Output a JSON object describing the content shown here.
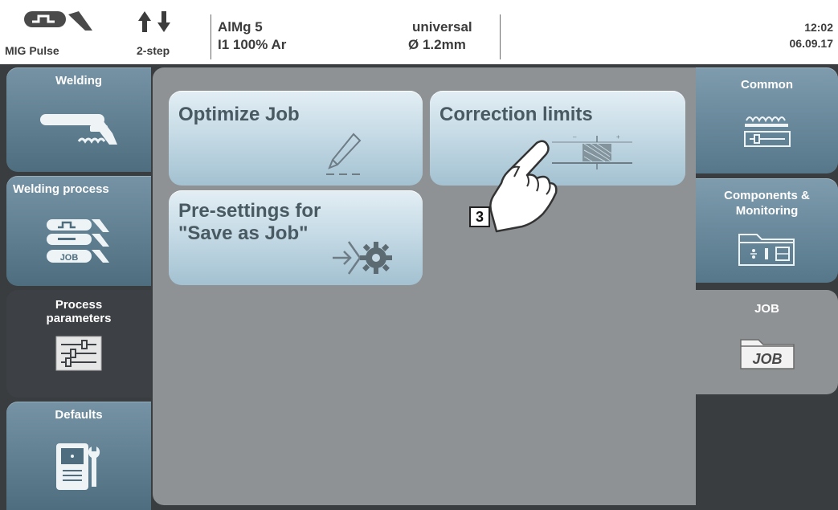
{
  "status_bar": {
    "process": "MIG Pulse",
    "mode": "2-step",
    "material": "AlMg 5",
    "gas": "I1 100% Ar",
    "characteristic": "universal",
    "wire_diameter": "Ø  1.2mm",
    "time": "12:02",
    "date": "06.09.17"
  },
  "left_sidebar": {
    "items": [
      {
        "label": "Welding",
        "icon": "welding-torch-icon"
      },
      {
        "label": "Welding process",
        "icon": "welding-process-icon",
        "badge": "JOB"
      },
      {
        "label": "Process\nparameters",
        "icon": "sliders-icon"
      },
      {
        "label": "Defaults",
        "icon": "power-source-wrench-icon"
      }
    ],
    "selected": "Process parameters"
  },
  "right_sidebar": {
    "items": [
      {
        "label": "Common",
        "icon": "common-settings-icon"
      },
      {
        "label": "Components &\nMonitoring",
        "icon": "components-folder-icon"
      },
      {
        "label": "JOB",
        "icon": "job-folder-icon",
        "icon_text": "JOB"
      }
    ],
    "selected": "JOB"
  },
  "main": {
    "tiles": [
      {
        "label": "Optimize Job",
        "icon": "pencil-icon"
      },
      {
        "label": "Correction limits",
        "icon": "correction-limits-icon"
      },
      {
        "label": "Pre-settings for\n\"Save as Job\"",
        "icon": "save-settings-gear-icon"
      }
    ]
  },
  "annotation": {
    "callout": "3",
    "pointer": "hand-pointer-icon"
  },
  "colors": {
    "frame": "#3a3d40",
    "main_panel": "#8f9295",
    "sidebar_button": "#5f7f92",
    "tile": "#c6dbe6",
    "tile_text": "#4a5a63"
  }
}
